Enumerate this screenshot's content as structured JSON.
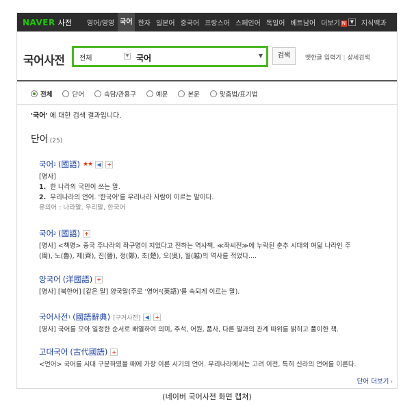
{
  "topnav": {
    "logo": "NAVER",
    "logo_sub": "사전",
    "items": [
      "영어/영영",
      "국어",
      "한자",
      "일본어",
      "중국어",
      "프랑스어",
      "스페인어",
      "독일어",
      "베트남어",
      "더보기"
    ],
    "active_item": "국어",
    "new_badge": "N",
    "more_dropdown_icon": "chevron-down",
    "last_item": "지식백과"
  },
  "search": {
    "title": "국어사전",
    "scope_value": "전체",
    "query_value": "국어",
    "button_label": "검색",
    "link1": "옛한글 입력기",
    "separator": "|",
    "link2": "상세검색"
  },
  "filters": {
    "selected": "전체",
    "options": [
      "전체",
      "단어",
      "속담/관용구",
      "예문",
      "본문",
      "맞춤법/표기법"
    ]
  },
  "intro": {
    "quoted": "'국어'",
    "rest": " 에 대한 검색 결과입니다."
  },
  "section": {
    "title": "단어",
    "count": "(25)"
  },
  "entries": [
    {
      "word": "국어",
      "sup": "1",
      "hanja": "(國語)",
      "stars": "★★",
      "lines": [
        {
          "text": "[명사]"
        },
        {
          "num": "1.",
          "text": "한 나라의 국민이 쓰는 말."
        },
        {
          "num": "2.",
          "text": "우리나라의 언어. '한국어'를 우리나라 사람이 이르는 말이다."
        },
        {
          "text": "유의어 : 나라말, 우리말, 한국어",
          "muted": true
        }
      ]
    },
    {
      "word": "국어",
      "sup": "2",
      "hanja": "(國語)",
      "lines": [
        {
          "text": "[명사] <책명> 중국 주나라의 좌구명이 지었다고 전하는 역사책. ≪좌씨전≫에 누락된 춘추 시대의 여덟 나라인 주"
        },
        {
          "text": "(周), 노(魯), 제(齊), 진(晉), 정(鄭), 초(楚), 오(吳), 월(越)의 역사를 적었다...."
        }
      ]
    },
    {
      "word": "양국어",
      "hanja": "(洋國語)",
      "lines": [
        {
          "text": "[명사] [북한어] [같은 말] 양국말(주로 '영어²(英語)'를 속되게 이르는 말)."
        }
      ]
    },
    {
      "word": "국어사전",
      "sup": "1",
      "hanja": "(國語辭典)",
      "note": "[구거사전]",
      "lines": [
        {
          "text": "[명사] 국어를 모아 일정한 순서로 배열하여 의미, 주석, 어원, 품사, 다른 말과의 관계 따위를 밝히고 풀이한 책."
        }
      ]
    },
    {
      "word": "고대국어",
      "hanja": "(古代國語)",
      "lines": [
        {
          "text": "<언어> 국어를 시대 구분하였을 때에 가장 이른 시기의 언어. 우리나라에서는 고려 이전, 특히 신라의 언어를 이른다."
        }
      ]
    }
  ],
  "more_link": "단어 더보기",
  "caption": "(네이버 국어사전 화면 캡쳐)"
}
